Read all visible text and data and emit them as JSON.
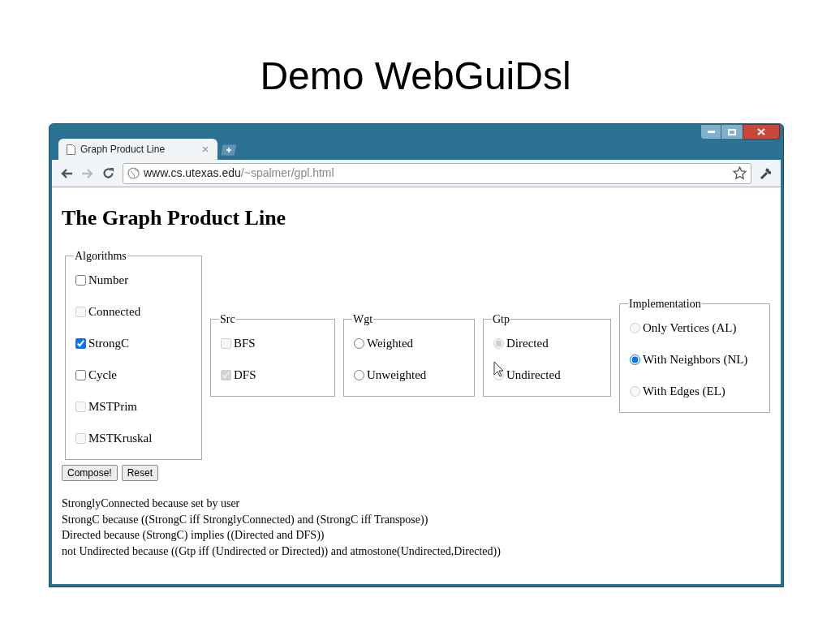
{
  "slide": {
    "title": "Demo WebGuiDsl"
  },
  "browser": {
    "tab": {
      "title": "Graph Product Line"
    },
    "url": {
      "host": "www.cs.utexas.edu",
      "path": "/~spalmer/gpl.html"
    }
  },
  "page": {
    "heading": "The Graph Product Line"
  },
  "groups": [
    {
      "legend": "Algorithms",
      "kind": "checkbox",
      "items": [
        {
          "label": "Number",
          "checked": false,
          "disabled": false
        },
        {
          "label": "Connected",
          "checked": false,
          "disabled": true
        },
        {
          "label": "StrongC",
          "checked": true,
          "disabled": false
        },
        {
          "label": "Cycle",
          "checked": false,
          "disabled": false
        },
        {
          "label": "MSTPrim",
          "checked": false,
          "disabled": true
        },
        {
          "label": "MSTKruskal",
          "checked": false,
          "disabled": true
        }
      ]
    },
    {
      "legend": "Src",
      "kind": "checkbox",
      "items": [
        {
          "label": "BFS",
          "checked": false,
          "disabled": true
        },
        {
          "label": "DFS",
          "checked": true,
          "disabled": true
        }
      ]
    },
    {
      "legend": "Wgt",
      "kind": "radio",
      "items": [
        {
          "label": "Weighted",
          "selected": false,
          "disabled": false
        },
        {
          "label": "Unweighted",
          "selected": false,
          "disabled": false
        }
      ]
    },
    {
      "legend": "Gtp",
      "kind": "radio",
      "items": [
        {
          "label": "Directed",
          "selected": true,
          "disabled": true
        },
        {
          "label": "Undirected",
          "selected": false,
          "disabled": true
        }
      ]
    },
    {
      "legend": "Implementation",
      "kind": "radio",
      "items": [
        {
          "label": "Only Vertices (AL)",
          "selected": false,
          "disabled": true
        },
        {
          "label": "With Neighbors (NL)",
          "selected": true,
          "disabled": false
        },
        {
          "label": "With Edges (EL)",
          "selected": false,
          "disabled": true
        }
      ]
    }
  ],
  "buttons": [
    "Compose!",
    "Reset"
  ],
  "explanations": [
    "StronglyConnected because set by user",
    "StrongC because ((StrongC iff StronglyConnected) and (StrongC iff Transpose))",
    "Directed because (StrongC) implies ((Directed and DFS))",
    "not Undirected because ((Gtp iff (Undirected or Directed)) and atmostone(Undirected,Directed))"
  ]
}
